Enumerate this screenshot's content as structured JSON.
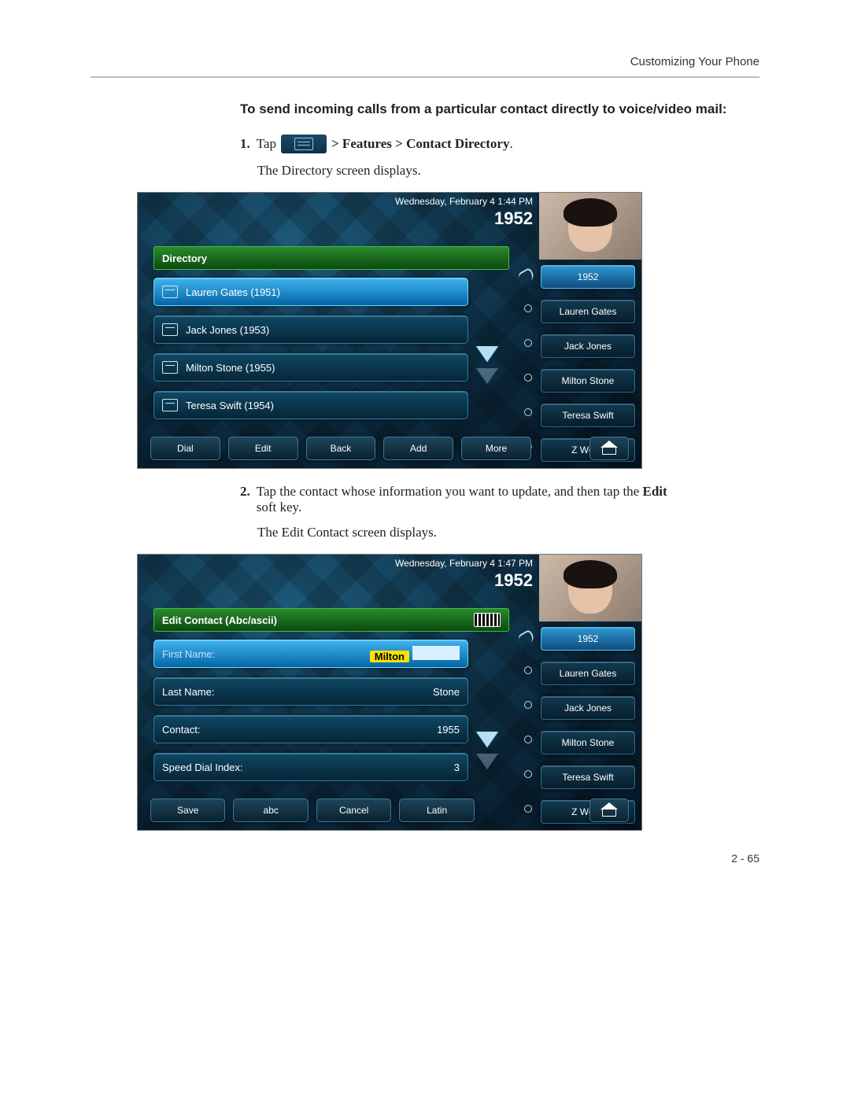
{
  "header": {
    "section": "Customizing Your Phone"
  },
  "intro": {
    "heading": "To send incoming calls from a particular contact directly to voice/video mail:"
  },
  "step1": {
    "num": "1.",
    "tap": "Tap",
    "features_path": " > Features > Contact Directory",
    "period": ".",
    "result": "The Directory screen displays."
  },
  "screen1": {
    "datetime": "Wednesday, February 4  1:44 PM",
    "line": "1952",
    "title": "Directory",
    "contacts": [
      "Lauren Gates (1951)",
      "Jack Jones (1953)",
      "Milton Stone (1955)",
      "Teresa Swift (1954)"
    ],
    "side": [
      "1952",
      "Lauren Gates",
      "Jack Jones",
      "Milton Stone",
      "Teresa Swift",
      "Z Wong"
    ],
    "softkeys": [
      "Dial",
      "Edit",
      "Back",
      "Add",
      "More"
    ]
  },
  "step2": {
    "num": "2.",
    "text_a": "Tap the contact whose information you want to update, and then tap the ",
    "edit": "Edit",
    "text_b": " soft key.",
    "result": "The Edit Contact screen displays."
  },
  "screen2": {
    "datetime": "Wednesday, February 4  1:47 PM",
    "line": "1952",
    "title": "Edit Contact (Abc/ascii)",
    "fields": [
      {
        "label": "First Name:",
        "value": "Milton",
        "highlight": true
      },
      {
        "label": "Last Name:",
        "value": "Stone"
      },
      {
        "label": "Contact:",
        "value": "1955"
      },
      {
        "label": "Speed Dial Index:",
        "value": "3"
      }
    ],
    "side": [
      "1952",
      "Lauren Gates",
      "Jack Jones",
      "Milton Stone",
      "Teresa Swift",
      "Z Wong"
    ],
    "softkeys": [
      "Save",
      "abc",
      "Cancel",
      "Latin"
    ]
  },
  "footer": {
    "page": "2 - 65"
  }
}
